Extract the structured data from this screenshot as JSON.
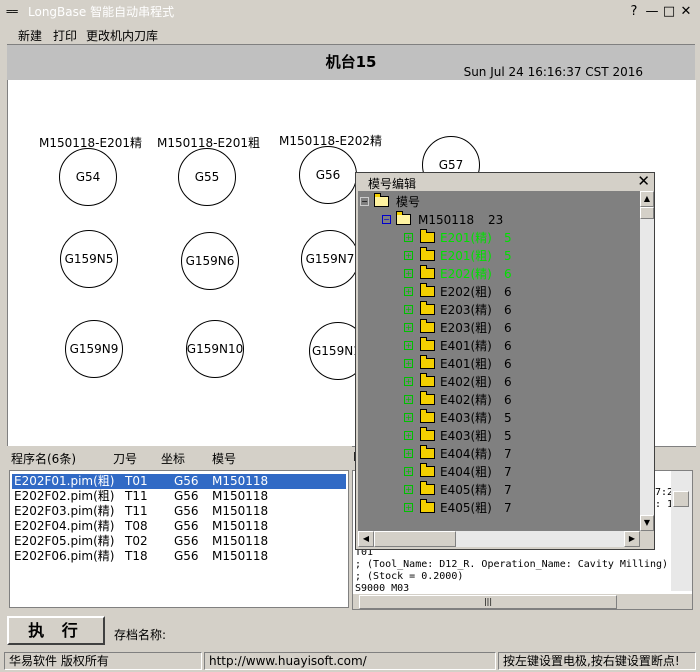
{
  "window": {
    "title": "LongBase 智能自动串程式",
    "logo": "==",
    "help": "?",
    "minimize": "—",
    "maximize": "□",
    "close": "✕"
  },
  "menu": [
    "新建",
    "打印",
    "更改机内刀库"
  ],
  "header": {
    "machine": "机台15",
    "datetime": "Sun Jul 24 16:16:37 CST 2016"
  },
  "tools": [
    {
      "label": "G54",
      "top_label": "M150118-E201精"
    },
    {
      "label": "G55",
      "top_label": "M150118-E201粗"
    },
    {
      "label": "G56",
      "top_label": "M150118-E202精"
    },
    {
      "label": "G57",
      "top_label": ""
    },
    {
      "label": "G159N5",
      "top_label": ""
    },
    {
      "label": "G159N6",
      "top_label": ""
    },
    {
      "label": "G159N7",
      "top_label": ""
    },
    {
      "label": "G159N9",
      "top_label": ""
    },
    {
      "label": "G159N10",
      "top_label": ""
    },
    {
      "label": "G159N1",
      "top_label": ""
    }
  ],
  "program_list": {
    "headers": [
      "程序名(6条)",
      "刀号",
      "坐标",
      "模号"
    ],
    "rows": [
      {
        "name": "E202F01.pim(粗)",
        "tool": "T01",
        "coord": "G56",
        "mold": "M150118"
      },
      {
        "name": "E202F02.pim(粗)",
        "tool": "T11",
        "coord": "G56",
        "mold": "M150118"
      },
      {
        "name": "E202F03.pim(精)",
        "tool": "T11",
        "coord": "G56",
        "mold": "M150118"
      },
      {
        "name": "E202F04.pim(精)",
        "tool": "T08",
        "coord": "G56",
        "mold": "M150118"
      },
      {
        "name": "E202F05.pim(精)",
        "tool": "T02",
        "coord": "G56",
        "mold": "M150118"
      },
      {
        "name": "E202F06.pim(精)",
        "tool": "T18",
        "coord": "G56",
        "mold": "M150118"
      }
    ]
  },
  "code": {
    "partial_right_1": "7:2",
    "partial_right_2": ": 1",
    "lines": [
      "T01",
      "; (Tool_Name: D12_R. Operation_Name: Cavity Milling)",
      "; (Stock = 0.2000)",
      "S9000 M03"
    ],
    "list_partial_header": "I"
  },
  "bottom": {
    "execute": "执 行",
    "save_label": "存档名称:"
  },
  "status": {
    "company": "华易软件 版权所有",
    "url": "http://www.huayisoft.com/",
    "hint": "按左键设置电极,按右键设置断点!"
  },
  "mold_dialog": {
    "title": "模号编辑",
    "close": "✕",
    "root": "模号",
    "mold": {
      "name": "M150118",
      "count": "23"
    },
    "items": [
      {
        "name": "E201(精)",
        "count": "5",
        "done": true
      },
      {
        "name": "E201(粗)",
        "count": "5",
        "done": true
      },
      {
        "name": "E202(精)",
        "count": "6",
        "done": true
      },
      {
        "name": "E202(粗)",
        "count": "6",
        "done": false
      },
      {
        "name": "E203(精)",
        "count": "6",
        "done": false
      },
      {
        "name": "E203(粗)",
        "count": "6",
        "done": false
      },
      {
        "name": "E401(精)",
        "count": "6",
        "done": false
      },
      {
        "name": "E401(粗)",
        "count": "6",
        "done": false
      },
      {
        "name": "E402(粗)",
        "count": "6",
        "done": false
      },
      {
        "name": "E402(精)",
        "count": "6",
        "done": false
      },
      {
        "name": "E403(精)",
        "count": "5",
        "done": false
      },
      {
        "name": "E403(粗)",
        "count": "5",
        "done": false
      },
      {
        "name": "E404(精)",
        "count": "7",
        "done": false
      },
      {
        "name": "E404(粗)",
        "count": "7",
        "done": false
      },
      {
        "name": "E405(精)",
        "count": "7",
        "done": false
      },
      {
        "name": "E405(粗)",
        "count": "7",
        "done": false
      }
    ]
  },
  "colors": {
    "done": "#00e000",
    "normal": "#000000",
    "selected": "#316ac5"
  }
}
